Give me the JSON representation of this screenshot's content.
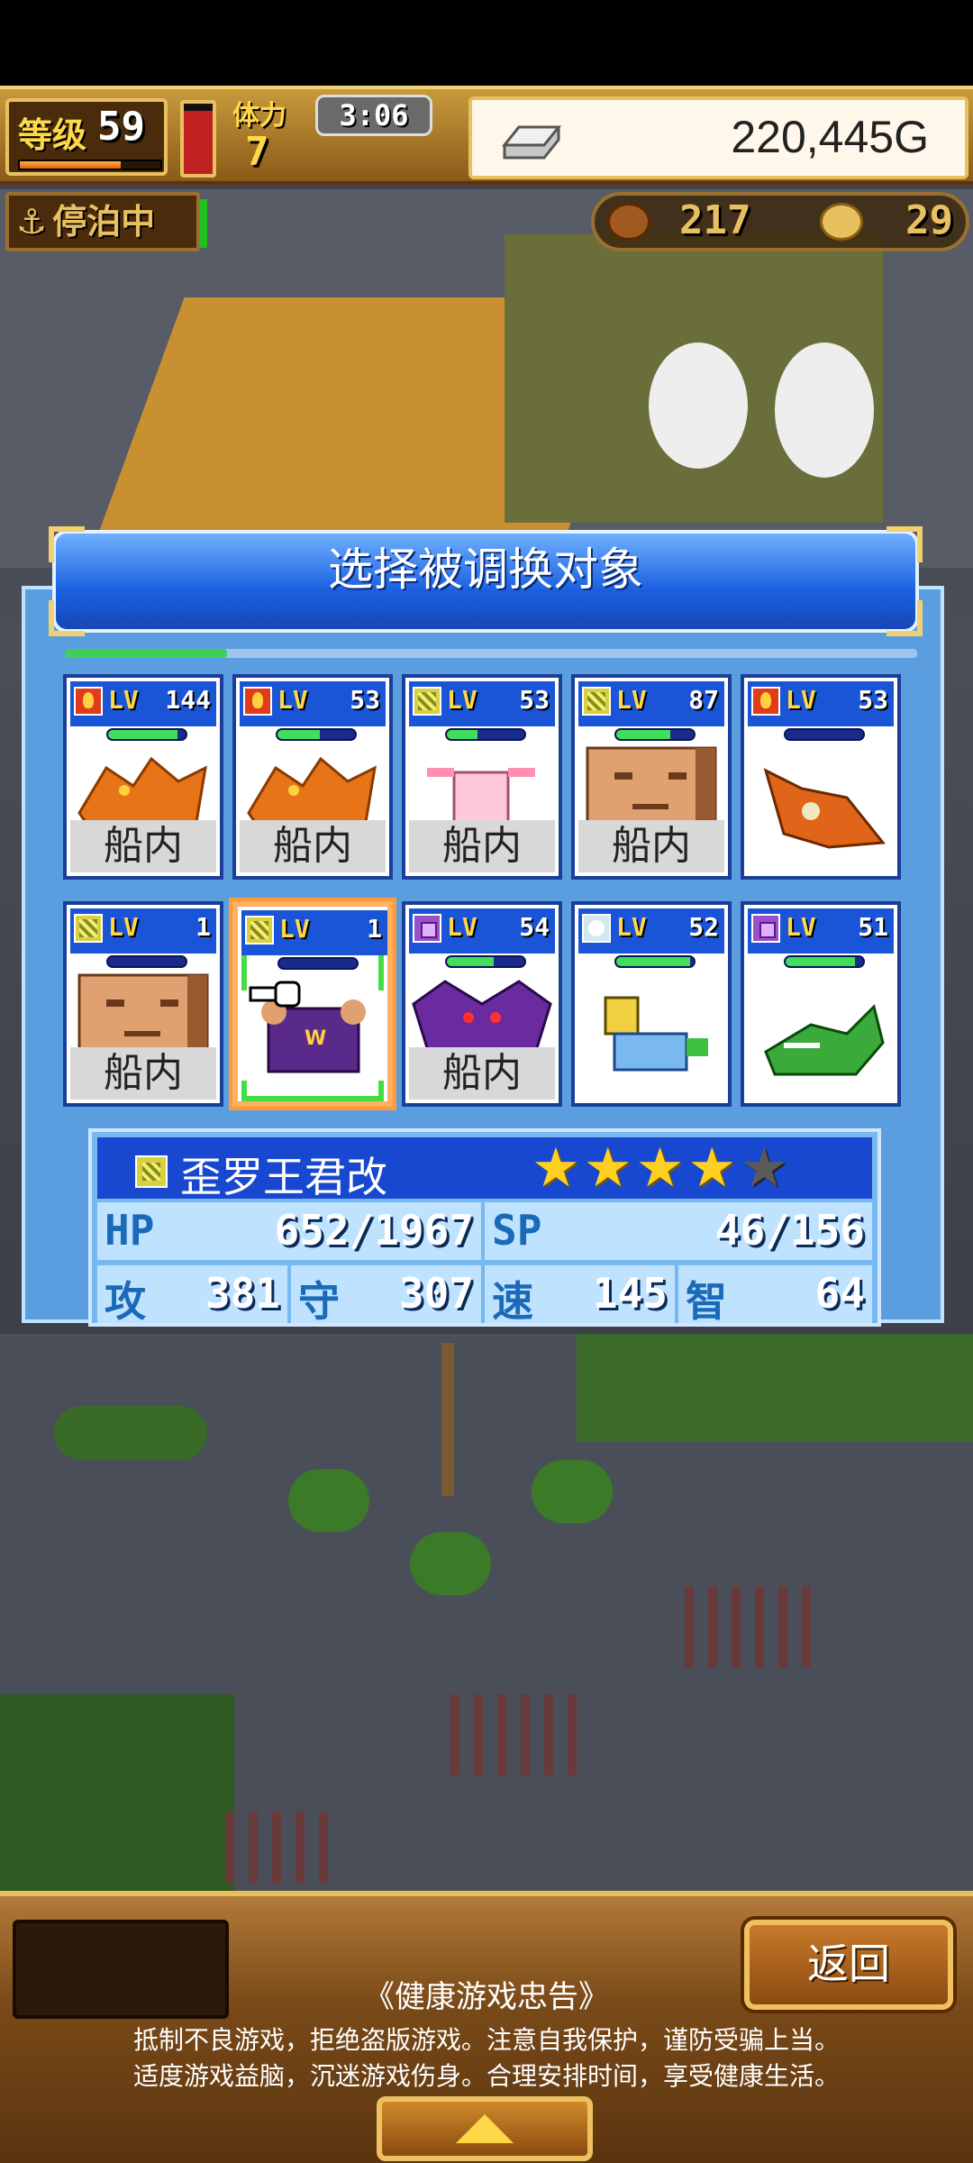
{
  "hud": {
    "level_label": "等级",
    "level_value": "59",
    "level_progress": 0.72,
    "stamina_label": "体力",
    "stamina_value": "7",
    "stamina_gauge": 0.9,
    "timer": "3:06",
    "gold": "220,445G",
    "dock_status": "停泊中",
    "resource_food": "217",
    "resource_coin": "29"
  },
  "dialog": {
    "title": "选择被调换对象",
    "progress": 0.19
  },
  "cards": [
    {
      "attr": "fire",
      "lv_label": "LV",
      "lv": "144",
      "hp": 0.9,
      "location": "船内",
      "portrait": "orange-dragon-icon"
    },
    {
      "attr": "fire",
      "lv_label": "LV",
      "lv": "53",
      "hp": 0.55,
      "location": "船内",
      "portrait": "orange-dragon-icon"
    },
    {
      "attr": "earth",
      "lv_label": "LV",
      "lv": "53",
      "hp": 0.4,
      "location": "船内",
      "portrait": "axolotl-icon"
    },
    {
      "attr": "earth",
      "lv_label": "LV",
      "lv": "87",
      "hp": 0.7,
      "location": "船内",
      "portrait": "stone-face-icon"
    },
    {
      "attr": "fire",
      "lv_label": "LV",
      "lv": "53",
      "hp": 0.0,
      "location": "",
      "portrait": "fire-lizard-icon"
    },
    {
      "attr": "earth",
      "lv_label": "LV",
      "lv": "1",
      "hp": 0.0,
      "location": "船内",
      "portrait": "stone-face-icon"
    },
    {
      "attr": "earth",
      "lv_label": "LV",
      "lv": "1",
      "hp": 0.0,
      "location": "",
      "portrait": "purple-king-icon",
      "selected": true
    },
    {
      "attr": "dark",
      "lv_label": "LV",
      "lv": "54",
      "hp": 0.6,
      "location": "船内",
      "portrait": "bat-demon-icon"
    },
    {
      "attr": "wind",
      "lv_label": "LV",
      "lv": "52",
      "hp": 0.95,
      "location": "",
      "portrait": "llama-robot-icon"
    },
    {
      "attr": "dark",
      "lv_label": "LV",
      "lv": "51",
      "hp": 0.9,
      "location": "",
      "portrait": "green-crocodile-icon"
    }
  ],
  "info": {
    "name": "歪罗王君改",
    "stars": 4,
    "stars_max": 5,
    "hp_label": "HP",
    "hp": "652/1967",
    "sp_label": "SP",
    "sp": "46/156",
    "atk_label": "攻",
    "atk": "381",
    "def_label": "守",
    "def": "307",
    "spd_label": "速",
    "spd": "145",
    "int_label": "智",
    "int": "64"
  },
  "bottom": {
    "back_label": "返回",
    "notice_title": "《健康游戏忠告》",
    "notice_line1": "抵制不良游戏，拒绝盗版游戏。注意自我保护，谨防受骗上当。",
    "notice_line2": "适度游戏益脑，沉迷游戏伤身。合理安排时间，享受健康生活。"
  },
  "colors": {
    "dialog_blue": "#5a9ee0",
    "card_head": "#1a55d8",
    "gold_trim": "#e8c060",
    "hp_green": "#3fdf5a"
  }
}
